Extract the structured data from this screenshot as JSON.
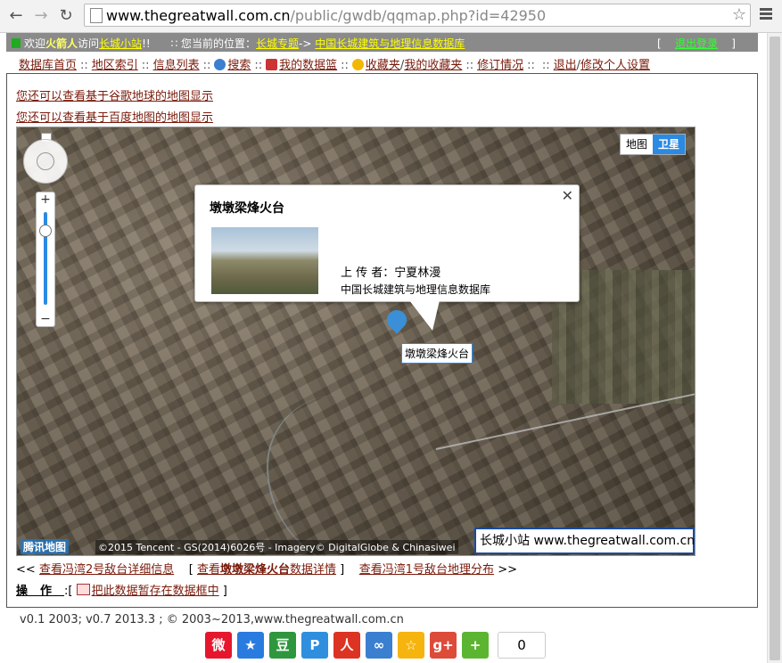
{
  "browser": {
    "url_host": "www.thegreatwall.com.cn",
    "url_path": "/public/gwdb/qqmap.php?id=42950"
  },
  "topbar": {
    "welcome_prefix": "欢迎",
    "username": "火箭人",
    "welcome_mid": "访问",
    "site_link": "长城小站",
    "welcome_suffix": "!!",
    "location_label": "∷ 您当前的位置：",
    "crumb1": "长城专题",
    "crumb_sep": "->",
    "crumb2": "中国长城建筑与地理信息数据库",
    "logout_left": "[",
    "logout": "退出登录",
    "logout_right": "]"
  },
  "nav": {
    "home": "数据库首页",
    "region": "地区索引",
    "list": "信息列表",
    "search": "搜索",
    "mybasket": "我的数据篮",
    "favorites": "收藏夹",
    "slash": "/",
    "myfavorites": "我的收藏夹",
    "revisions": "修订情况",
    "logout": "退出",
    "settings": "修改个人设置",
    "sep": "::"
  },
  "links": {
    "google_map": "您还可以查看基于谷歌地球的地图显示",
    "baidu_map": "您还可以查看基于百度地图的地图显示"
  },
  "map": {
    "type_map": "地图",
    "type_sat": "卫星",
    "popup_title": "墩墩梁烽火台",
    "popup_uploader": "上 传 者：宁夏林漫",
    "popup_source": "中国长城建筑与地理信息数据库",
    "close": "✕",
    "pin_label": "墩墩梁烽火台",
    "logo": "腾讯地图",
    "copyright": "©2015 Tencent - GS(2014)6026号 - Imagery© DigitalGlobe & Chinasiwei",
    "watermark": "长城小站 www.thegreatwall.com.cn",
    "zoom_level": 0.85
  },
  "mapnav": {
    "prev_arrow": "<<",
    "prev": "查看冯湾2号敌台详细信息",
    "cur_left": "[",
    "cur_pre": "查看",
    "cur_name": "墩墩梁烽火台",
    "cur_post": "数据详情",
    "cur_right": "]",
    "next": "查看冯湾1号敌台地理分布",
    "next_arrow": ">>"
  },
  "ops": {
    "label": "操作",
    "colon": ":[",
    "action": "把此数据暂存在数据框中",
    "end": "]"
  },
  "footer": {
    "version": "v0.1 2003; v0.7 2013.3 ; © 2003~2013,www.thegreatwall.com.cn",
    "share_count": "0"
  },
  "colors": {
    "link": "#7a1a0a",
    "topbar_bg": "#8a8a8a",
    "accent_blue": "#2b8ae2"
  }
}
